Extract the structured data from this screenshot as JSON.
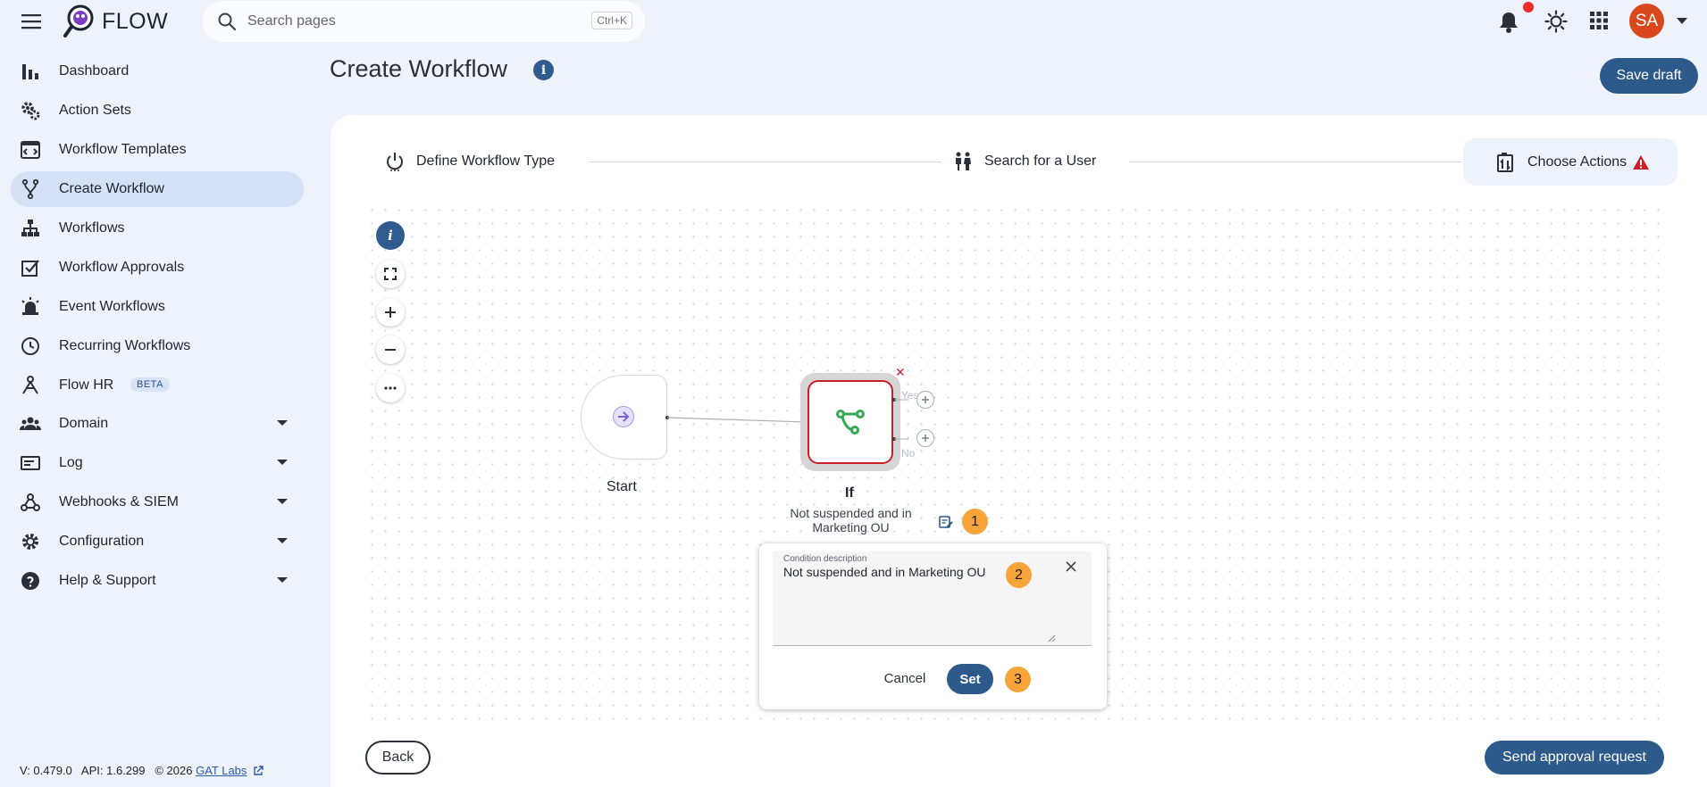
{
  "app": {
    "name": "FLOW"
  },
  "search": {
    "placeholder": "Search pages",
    "shortcut": "Ctrl+K"
  },
  "user": {
    "initials": "SA"
  },
  "colors": {
    "primary": "#2d5a8b",
    "avatar": "#d9481c",
    "badge": "#f7a43a",
    "error": "#c81f2b",
    "active_nav": "#d6e0f7"
  },
  "sidebar": {
    "items": [
      {
        "label": "Dashboard",
        "icon": "bar-chart-icon"
      },
      {
        "label": "Action Sets",
        "icon": "gears-icon"
      },
      {
        "label": "Workflow Templates",
        "icon": "template-icon"
      },
      {
        "label": "Create Workflow",
        "icon": "fork-icon",
        "active": true
      },
      {
        "label": "Workflows",
        "icon": "sitemap-icon"
      },
      {
        "label": "Workflow Approvals",
        "icon": "approval-icon"
      },
      {
        "label": "Event Workflows",
        "icon": "siren-icon"
      },
      {
        "label": "Recurring Workflows",
        "icon": "clock-icon"
      },
      {
        "label": "Flow HR",
        "icon": "hr-icon",
        "badge": "BETA"
      },
      {
        "label": "Domain",
        "icon": "group-icon",
        "expandable": true
      },
      {
        "label": "Log",
        "icon": "log-icon",
        "expandable": true
      },
      {
        "label": "Webhooks & SIEM",
        "icon": "webhook-icon",
        "expandable": true
      },
      {
        "label": "Configuration",
        "icon": "gear-icon",
        "expandable": true
      },
      {
        "label": "Help & Support",
        "icon": "help-icon",
        "expandable": true
      }
    ]
  },
  "footer": {
    "version": "V: 0.479.0",
    "api": "API: 1.6.299",
    "copyright": "© 2026",
    "company": "GAT Labs"
  },
  "page": {
    "title": "Create Workflow",
    "save_draft": "Save draft"
  },
  "stepper": {
    "steps": [
      {
        "label": "Define Workflow Type",
        "icon": "power-icon"
      },
      {
        "label": "Search for a User",
        "icon": "users-icon"
      },
      {
        "label": "Choose Actions",
        "icon": "actions-icon",
        "active": true,
        "warning": true
      }
    ]
  },
  "canvas": {
    "start_label": "Start",
    "if_node": {
      "label": "If",
      "description": "Not suspended and in Marketing OU",
      "yes_label": "Yes",
      "no_label": "No"
    },
    "badges": [
      "1",
      "2",
      "3"
    ]
  },
  "condition_popup": {
    "field_label": "Condition description",
    "field_value": "Not suspended and in Marketing OU",
    "cancel": "Cancel",
    "set": "Set"
  },
  "actions": {
    "back": "Back",
    "send_approval": "Send approval request"
  }
}
